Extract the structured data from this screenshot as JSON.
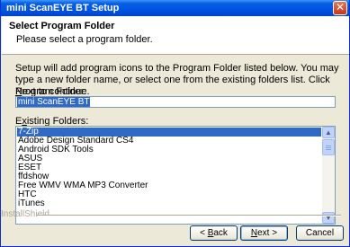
{
  "window": {
    "title": "mini ScanEYE BT Setup",
    "close_glyph": "✕"
  },
  "header": {
    "title": "Select Program Folder",
    "subtitle": "Please select a program folder."
  },
  "instruction": "Setup will add program icons to the Program Folder listed below.  You may type a new folder name, or select one from the existing folders list.  Click Next to continue.",
  "program_folder": {
    "label_prefix": "",
    "label_mnemonic": "P",
    "label_rest": "rogram Folder:",
    "value": "mini ScanEYE BT"
  },
  "existing_folders": {
    "label_prefix": "E",
    "label_mnemonic": "x",
    "label_rest": "isting Folders:",
    "items": [
      "7-Zip",
      "Adobe Design Standard CS4",
      "Android SDK Tools",
      "ASUS",
      "ESET",
      "ffdshow",
      "Free WMV WMA MP3 Converter",
      "HTC",
      "iTunes"
    ],
    "selected_index": 0
  },
  "footer": {
    "brand": "InstallShield"
  },
  "buttons": {
    "back_prefix": "< ",
    "back_mnemonic": "B",
    "back_rest": "ack",
    "next_mnemonic": "N",
    "next_rest": "ext >",
    "cancel": "Cancel"
  },
  "icons": {
    "close": "close-icon",
    "scroll_up": "scroll-up-arrow-icon",
    "scroll_down": "scroll-down-arrow-icon"
  },
  "colors": {
    "titlebar": "#0054e3",
    "selection": "#316ac5",
    "dialog_bg": "#ece9d8"
  }
}
